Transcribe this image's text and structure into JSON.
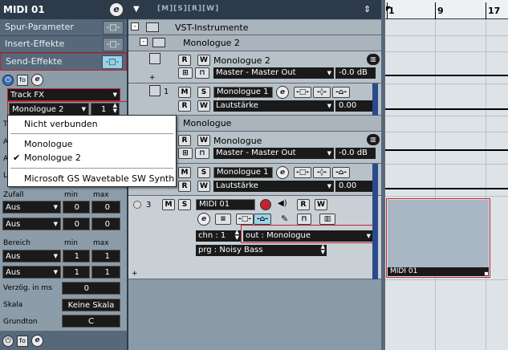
{
  "inspector": {
    "title": "MIDI 01",
    "e_label": "e",
    "sections": [
      {
        "label": "Spur-Parameter"
      },
      {
        "label": "Insert-Effekte"
      },
      {
        "label": "Send-Effekte"
      }
    ],
    "track_fx": "Track FX",
    "send_dest": "Monologue 2",
    "send_num": "1",
    "zufall_label": "Zufall",
    "min_label": "min",
    "max_label": "max",
    "zufall_rows": [
      {
        "mode": "Aus",
        "min": "0",
        "max": "0"
      },
      {
        "mode": "Aus",
        "min": "0",
        "max": "0"
      }
    ],
    "bereich_label": "Bereich",
    "bereich_rows": [
      {
        "mode": "Aus",
        "min": "1",
        "max": "1"
      },
      {
        "mode": "Aus",
        "min": "1",
        "max": "1"
      }
    ],
    "verz_label": "Verzög. in ms",
    "verz_value": "0",
    "skala_label": "Skala",
    "skala_value": "Keine Skala",
    "grundton_label": "Grundton",
    "grundton_value": "C",
    "left_letters": [
      "Tr",
      "A",
      "A",
      "La"
    ]
  },
  "popup": {
    "items": [
      "Nicht verbunden",
      "Monologue",
      "Monologue 2",
      "Microsoft GS Wavetable SW Synth"
    ],
    "checked_index": 2
  },
  "tracks": {
    "folder": "VST-Instrumente",
    "group1": "Monologue 2",
    "inst1": {
      "name": "Monologue 2",
      "out": "Master - Master Out",
      "vol": "-0.0 dB"
    },
    "midi1": {
      "num": "1",
      "name": "Monologue 1 (",
      "param": "Lautstärke",
      "val": "0.00"
    },
    "group2": "Monologue",
    "inst2": {
      "name": "Monologue",
      "out": "Master - Master Out",
      "vol": "-0.0 dB"
    },
    "midi2": {
      "name": "Monologue 1",
      "param": "Lautstärke",
      "val": "0.00"
    },
    "midi3": {
      "num": "3",
      "name": "MIDI 01",
      "chn": "chn : 1",
      "out": "out : Monologue",
      "prg": "prg : Noisy Bass"
    }
  },
  "ruler": {
    "marks": [
      "1",
      "9",
      "17"
    ]
  },
  "part": {
    "name": "MIDI 01"
  },
  "colors": {
    "accent_red": "#c3232f",
    "part_fill": "#a9b6c4"
  }
}
